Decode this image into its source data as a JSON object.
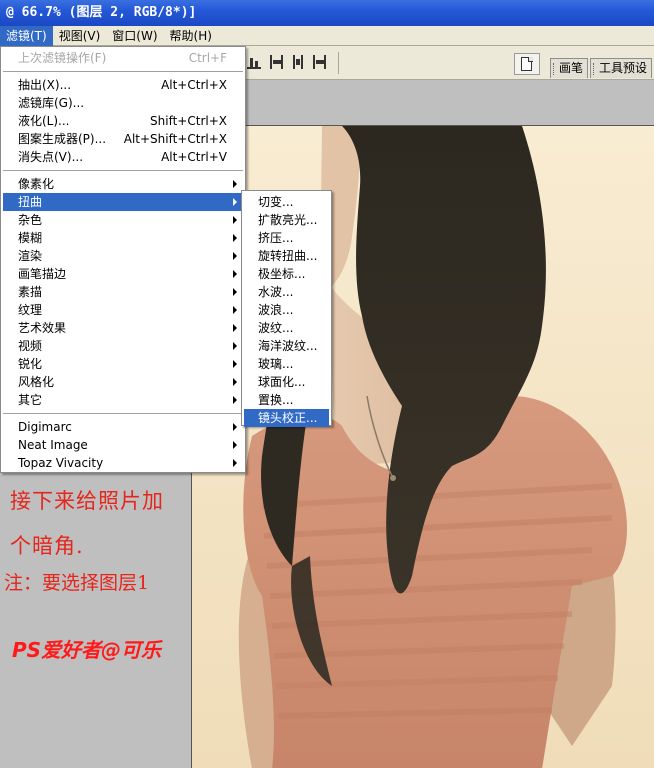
{
  "window": {
    "title": "@ 66.7% (图层 2, RGB/8*)]"
  },
  "menubar": [
    {
      "label": "滤镜(T)"
    },
    {
      "label": "视图(V)"
    },
    {
      "label": "窗口(W)"
    },
    {
      "label": "帮助(H)"
    }
  ],
  "tabs": [
    {
      "label": "画笔"
    },
    {
      "label": "工具预设"
    }
  ],
  "filter_menu": {
    "last_filter": {
      "label": "上次滤镜操作(F)",
      "shortcut": "Ctrl+F"
    },
    "group1": [
      {
        "label": "抽出(X)...",
        "shortcut": "Alt+Ctrl+X"
      },
      {
        "label": "滤镜库(G)...",
        "shortcut": ""
      },
      {
        "label": "液化(L)...",
        "shortcut": "Shift+Ctrl+X"
      },
      {
        "label": "图案生成器(P)...",
        "shortcut": "Alt+Shift+Ctrl+X"
      },
      {
        "label": "消失点(V)...",
        "shortcut": "Alt+Ctrl+V"
      }
    ],
    "group2": [
      {
        "label": "像素化"
      },
      {
        "label": "扭曲"
      },
      {
        "label": "杂色"
      },
      {
        "label": "模糊"
      },
      {
        "label": "渲染"
      },
      {
        "label": "画笔描边"
      },
      {
        "label": "素描"
      },
      {
        "label": "纹理"
      },
      {
        "label": "艺术效果"
      },
      {
        "label": "视频"
      },
      {
        "label": "锐化"
      },
      {
        "label": "风格化"
      },
      {
        "label": "其它"
      }
    ],
    "group3": [
      {
        "label": "Digimarc"
      },
      {
        "label": "Neat Image"
      },
      {
        "label": "Topaz Vivacity"
      }
    ]
  },
  "distort_submenu": [
    {
      "label": "切变..."
    },
    {
      "label": "扩散亮光..."
    },
    {
      "label": "挤压..."
    },
    {
      "label": "旋转扭曲..."
    },
    {
      "label": "极坐标..."
    },
    {
      "label": "水波..."
    },
    {
      "label": "波浪..."
    },
    {
      "label": "波纹..."
    },
    {
      "label": "海洋波纹..."
    },
    {
      "label": "玻璃..."
    },
    {
      "label": "球面化..."
    },
    {
      "label": "置换..."
    },
    {
      "label": "镜头校正..."
    }
  ],
  "caption": {
    "line1": "接下来给照片加",
    "line2": "个暗角.",
    "line3": "注：要选择图层1",
    "signature": "PS爱好者@可乐"
  },
  "colors": {
    "highlight": "#316ac5",
    "caption": "#e5261c"
  },
  "icons": [
    "align-icon",
    "document-icon",
    "submenu-arrow-icon"
  ]
}
